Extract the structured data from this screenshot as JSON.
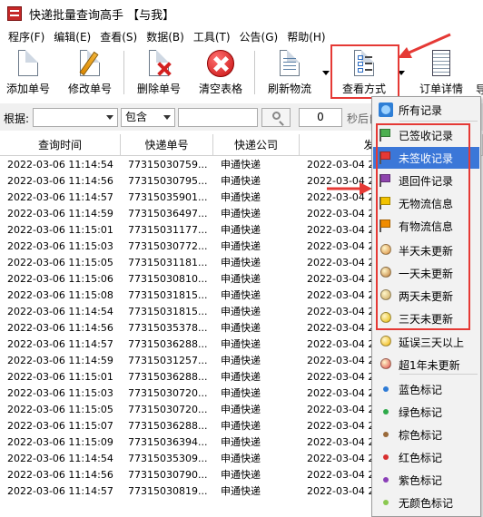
{
  "window": {
    "title": "快递批量查询高手 【与我】"
  },
  "menu": [
    "程序(F)",
    "编辑(E)",
    "查看(S)",
    "数据(B)",
    "工具(T)",
    "公告(G)",
    "帮助(H)"
  ],
  "toolbar": {
    "add": "添加单号",
    "edit": "修改单号",
    "delete": "删除单号",
    "clear": "清空表格",
    "refresh": "刷新物流",
    "view_mode": "查看方式",
    "details": "订单详情",
    "overflow": "导"
  },
  "search": {
    "label": "根据:",
    "field_value": "",
    "match_value": "包含",
    "keyword_value": "",
    "interval_value": "0",
    "interval_suffix": "秒后自"
  },
  "table": {
    "columns": [
      "查询时间",
      "快递单号",
      "快递公司",
      "发出物流时"
    ],
    "rows": [
      [
        "2022-03-06 11:14:54",
        "77315030759...",
        "申通快递",
        "2022-03-04 2"
      ],
      [
        "2022-03-06 11:14:56",
        "77315030795...",
        "申通快递",
        "2022-03-04 2"
      ],
      [
        "2022-03-06 11:14:57",
        "77315035901...",
        "申通快递",
        "2022-03-04 2"
      ],
      [
        "2022-03-06 11:14:59",
        "77315036497...",
        "申通快递",
        "2022-03-04 2"
      ],
      [
        "2022-03-06 11:15:01",
        "77315031177...",
        "申通快递",
        "2022-03-04 2"
      ],
      [
        "2022-03-06 11:15:03",
        "77315030772...",
        "申通快递",
        "2022-03-04 2"
      ],
      [
        "2022-03-06 11:15:05",
        "77315031181...",
        "申通快递",
        "2022-03-04 2"
      ],
      [
        "2022-03-06 11:15:06",
        "77315030810...",
        "申通快递",
        "2022-03-04 2"
      ],
      [
        "2022-03-06 11:15:08",
        "77315031815...",
        "申通快递",
        "2022-03-04 2"
      ],
      [
        "2022-03-06 11:14:54",
        "77315031815...",
        "申通快递",
        "2022-03-04 2"
      ],
      [
        "2022-03-06 11:14:56",
        "77315035378...",
        "申通快递",
        "2022-03-04 2"
      ],
      [
        "2022-03-06 11:14:57",
        "77315036288...",
        "申通快递",
        "2022-03-04 2"
      ],
      [
        "2022-03-06 11:14:59",
        "77315031257...",
        "申通快递",
        "2022-03-04 2"
      ],
      [
        "2022-03-06 11:15:01",
        "77315036288...",
        "申通快递",
        "2022-03-04 2"
      ],
      [
        "2022-03-06 11:15:03",
        "77315030720...",
        "申通快递",
        "2022-03-04 2"
      ],
      [
        "2022-03-06 11:15:05",
        "77315030720...",
        "申通快递",
        "2022-03-04 2"
      ],
      [
        "2022-03-06 11:15:07",
        "77315036288...",
        "申通快递",
        "2022-03-04 2"
      ],
      [
        "2022-03-06 11:15:09",
        "77315036394...",
        "申通快递",
        "2022-03-04 2"
      ],
      [
        "2022-03-06 11:14:54",
        "77315035309...",
        "申通快递",
        "2022-03-04 2"
      ],
      [
        "2022-03-06 11:14:56",
        "77315030790...",
        "申通快递",
        "2022-03-04 2"
      ],
      [
        "2022-03-06 11:14:57",
        "77315030819...",
        "申通快递",
        "2022-03-04 2"
      ]
    ]
  },
  "view_menu": {
    "items": [
      {
        "label": "所有记录",
        "icon": "all-records-icon"
      },
      {
        "label": "已签收记录",
        "icon": "green-flag-icon",
        "color": "#4caf50"
      },
      {
        "label": "未签收记录",
        "icon": "red-flag-icon",
        "color": "#e53935"
      },
      {
        "label": "退回件记录",
        "icon": "purple-flag-icon",
        "color": "#8e44ad"
      },
      {
        "label": "无物流信息",
        "icon": "yellow-flag-icon",
        "color": "#f2c200"
      },
      {
        "label": "有物流信息",
        "icon": "orange-flag-icon",
        "color": "#f08c00"
      },
      {
        "label": "半天未更新",
        "icon": "bronze-medal-icon",
        "color": "#d98a3a"
      },
      {
        "label": "一天未更新",
        "icon": "bronze-medal-icon",
        "color": "#c07a34"
      },
      {
        "label": "两天未更新",
        "icon": "silver-medal-icon",
        "color": "#c9a45a"
      },
      {
        "label": "三天未更新",
        "icon": "gold-medal-icon",
        "color": "#e6b800"
      },
      {
        "label": "延误三天以上",
        "icon": "gold-medal-icon",
        "color": "#f0b400"
      },
      {
        "label": "超1年未更新",
        "icon": "red-medal-icon",
        "color": "#e04848"
      },
      {
        "label": "蓝色标记",
        "icon": "blue-dot-icon",
        "color": "#2e7bd6"
      },
      {
        "label": "绿色标记",
        "icon": "green-dot-icon",
        "color": "#2eaa4a"
      },
      {
        "label": "棕色标记",
        "icon": "brown-dot-icon",
        "color": "#9a6a3a"
      },
      {
        "label": "红色标记",
        "icon": "red-dot-icon",
        "color": "#d83030"
      },
      {
        "label": "紫色标记",
        "icon": "purple-dot-icon",
        "color": "#8a3fb8"
      },
      {
        "label": "无颜色标记",
        "icon": "no-color-dot-icon",
        "color": "#8ac850"
      }
    ],
    "selected_index": 2
  },
  "colors": {
    "highlight": "#e53935",
    "selection": "#3b77d8"
  }
}
